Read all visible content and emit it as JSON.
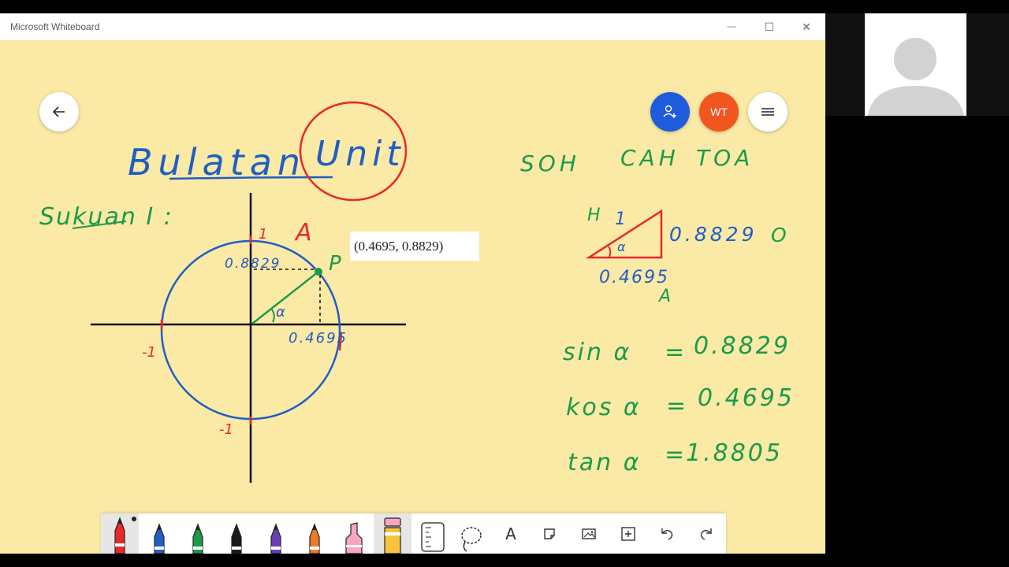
{
  "window": {
    "title": "Microsoft Whiteboard",
    "controls": {
      "minimize": "—",
      "maximize": "☐",
      "close": "✕"
    }
  },
  "header": {
    "avatar_initials": "WT",
    "colors": {
      "add_user": "#1e5cdc",
      "avatar": "#f0561e",
      "canvas": "#fbe9a6"
    }
  },
  "canvas": {
    "title": {
      "word1": "Bulatan",
      "word2": "Unit"
    },
    "subtitle": "Sukuan I :",
    "axes": {
      "top": "1",
      "left": "-1",
      "bottom": "-1"
    },
    "point_label": "P",
    "quadrant_label": "A",
    "angle_label": "α",
    "y_value": "0.8829",
    "x_value": "0.4695",
    "coordinate_tooltip": "(0.4695, 0.8829)",
    "mnemonic": [
      "SOH",
      "CAH",
      "TOA"
    ],
    "triangle": {
      "hyp_letter": "H",
      "hyp_value": "1",
      "opp_value": "0.8829",
      "opp_letter": "O",
      "adj_value": "0.4695",
      "adj_letter": "A",
      "angle": "α"
    },
    "equations": [
      {
        "lhs": "sin α",
        "eq": "=",
        "rhs": "0.8829"
      },
      {
        "lhs": "kos α",
        "eq": "=",
        "rhs": "0.4695"
      },
      {
        "lhs": "tan α",
        "eq": "=",
        "rhs": "1.8805"
      }
    ]
  },
  "toolbar": {
    "tools": [
      {
        "name": "red-pen",
        "color": "#e8282b"
      },
      {
        "name": "blue-pen",
        "color": "#1f5fc4"
      },
      {
        "name": "green-pen",
        "color": "#1a9b4b"
      },
      {
        "name": "black-pen",
        "color": "#1a1a1a"
      },
      {
        "name": "purple-pen",
        "color": "#6a3fb5"
      },
      {
        "name": "orange-pen",
        "color": "#f07a2a"
      },
      {
        "name": "pink-highlighter",
        "color": "#f6a6c1"
      },
      {
        "name": "yellow-highlighter",
        "color": "#f7c53b"
      }
    ],
    "text_tool_glyph": "A"
  }
}
